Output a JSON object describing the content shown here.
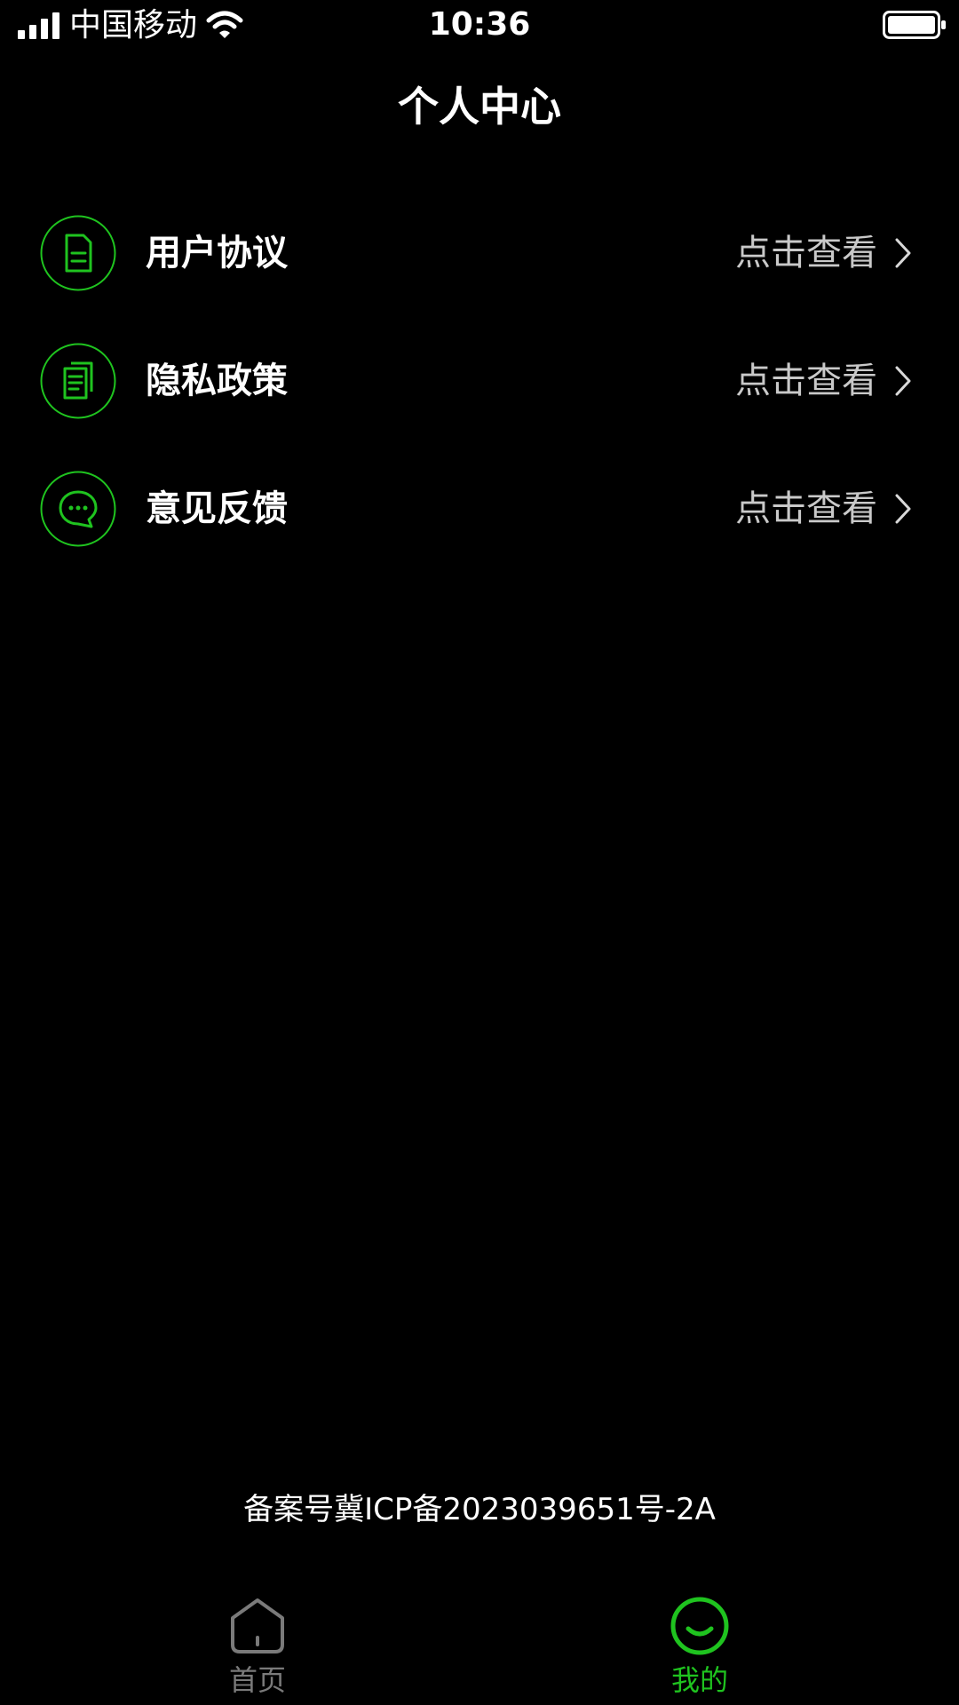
{
  "status_bar": {
    "carrier": "中国移动",
    "time": "10:36",
    "icons": [
      "signal-icon",
      "wifi-icon",
      "battery-icon"
    ]
  },
  "header": {
    "title": "个人中心"
  },
  "menu": {
    "items": [
      {
        "label": "用户协议",
        "action": "点击查看",
        "icon": "document-icon"
      },
      {
        "label": "隐私政策",
        "action": "点击查看",
        "icon": "documents-stack-icon"
      },
      {
        "label": "意见反馈",
        "action": "点击查看",
        "icon": "chat-bubble-icon"
      }
    ]
  },
  "footer": {
    "icp": "备案号冀ICP备2023039651号-2A"
  },
  "tab_bar": {
    "tabs": [
      {
        "label": "首页",
        "icon": "home-icon",
        "active": false
      },
      {
        "label": "我的",
        "icon": "smile-icon",
        "active": true
      }
    ]
  },
  "colors": {
    "background": "#000000",
    "accent": "#1fc31f",
    "text_primary": "#ffffff",
    "text_secondary": "#c9c9c9",
    "tab_inactive": "#7a7a7a"
  }
}
